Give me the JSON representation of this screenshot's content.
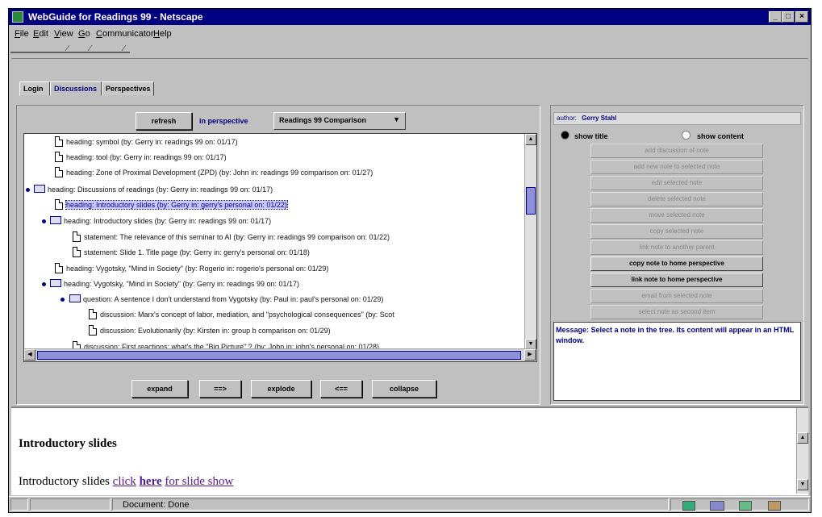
{
  "window": {
    "title": "WebGuide for Readings 99 - Netscape",
    "minimize": "_",
    "maximize": "□",
    "close": "×"
  },
  "menu": [
    "File",
    "Edit",
    "View",
    "Go",
    "Communicator",
    "Help"
  ],
  "tabs": [
    "Login",
    "Discussions",
    "Perspectives"
  ],
  "active_tab": "Discussions",
  "discussions": {
    "refresh_label": "refresh",
    "perspective_label": "in perspective",
    "perspective_value": "Readings 99 Comparison",
    "tree": [
      {
        "icon": "doc",
        "text": "heading:  symbol  (by: Gerry in: readings 99 on: 01/17)"
      },
      {
        "icon": "doc",
        "text": "heading:  tool  (by: Gerry in: readings 99 on: 01/17)"
      },
      {
        "icon": "doc",
        "text": "heading:  Zone of Proximal Development (ZPD)  (by: John in: readings 99 comparison on: 01/27)"
      },
      {
        "icon": "folder",
        "text": "heading:  Discussions of readings  (by: Gerry in: readings 99 on: 01/17)"
      },
      {
        "icon": "doc",
        "text": "heading:  Introductory slides  (by: Gerry in: gerry's personal on: 01/22)"
      },
      {
        "icon": "folder",
        "text": "heading:  Introductory slides  (by: Gerry in: readings 99 on: 01/17)"
      },
      {
        "icon": "doc",
        "text": "statement:  The relevance of this seminar to AI  (by: Gerry in: readings 99 comparison on: 01/22)"
      },
      {
        "icon": "doc",
        "text": "statement:  Slide 1. Title page  (by: Gerry in: gerry's personal on: 01/18)"
      },
      {
        "icon": "doc",
        "text": "heading:  Vygotsky, \"Mind in Society\"  (by: Rogerio in: rogerio's personal on: 01/29)"
      },
      {
        "icon": "folder",
        "text": "heading:  Vygotsky, \"Mind in Society\"  (by: Gerry in: readings 99 on: 01/17)"
      },
      {
        "icon": "folder",
        "text": "question:  A sentence I don't understand from Vygotsky  (by: Paul in: paul's personal on: 01/29)"
      },
      {
        "icon": "doc",
        "text": "discussion:  Marx's concept of labor, mediation, and \"psychological consequences\"  (by: Scot"
      },
      {
        "icon": "doc",
        "text": "discussion:  Evolutionarily  (by: Kirsten in: group b comparison on: 01/29)"
      },
      {
        "icon": "doc",
        "text": "discussion:  First reactions: what's the \"Big Picture\" ?  (by: John in: john's personal on: 01/28)"
      }
    ],
    "buttons": {
      "expand": "expand",
      "forward": "==>",
      "explode": "explode",
      "back": "<==",
      "collapse": "collapse"
    }
  },
  "side": {
    "author_label": "author:",
    "author_value": "Gerry Stahl",
    "show_title": "show title",
    "show_content": "show content",
    "actions": [
      {
        "label": "add discussion of note",
        "enabled": false
      },
      {
        "label": "add new note to selected note",
        "enabled": false
      },
      {
        "label": "edit selected note",
        "enabled": false
      },
      {
        "label": "delete selected note",
        "enabled": false
      },
      {
        "label": "move selected note",
        "enabled": false
      },
      {
        "label": "copy selected note",
        "enabled": false
      },
      {
        "label": "link note to another parent",
        "enabled": false
      },
      {
        "label": "copy note to home perspective",
        "enabled": true
      },
      {
        "label": "link note to home perspective",
        "enabled": true
      },
      {
        "label": "email from selected note",
        "enabled": false
      },
      {
        "label": "select note as second item",
        "enabled": false
      }
    ],
    "message": "Message: Select a note in the tree. Its content will appear in an HTML window."
  },
  "document": {
    "heading": "Introductory slides",
    "text_prefix": "Introductory slides ",
    "link_1": "click",
    "link_2": "here",
    "link_3": "for slide show"
  },
  "status": {
    "text": "Document: Done"
  },
  "colors": {
    "titlebar": "#000080",
    "chrome": "#c0c0c0",
    "selection": "#c8c8ff",
    "link": "#551a8b"
  }
}
